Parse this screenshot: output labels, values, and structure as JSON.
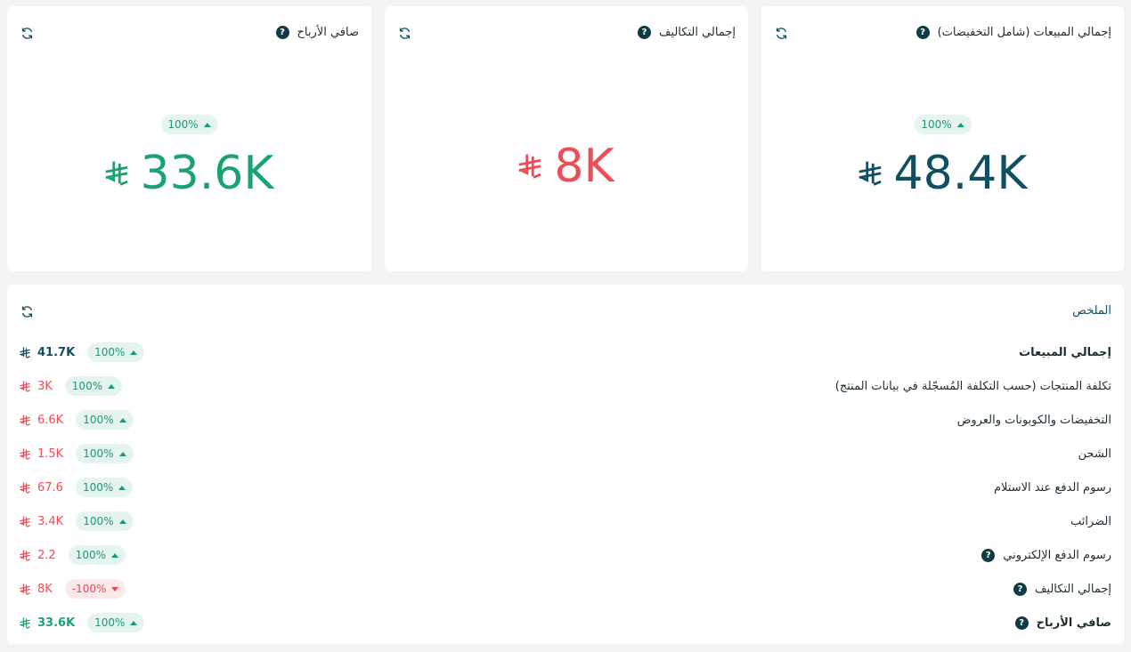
{
  "colors": {
    "primary": "#0f4f5f",
    "positive": "#1aa36f",
    "negative": "#ec4d57",
    "badge_up_bg": "#e4f5ee",
    "badge_down_bg": "#fde9ea"
  },
  "kpis": {
    "sales": {
      "title": "إجمالي المبيعات (شامل التخفيضات)",
      "help": "?",
      "change": "100%",
      "value": "48.4K",
      "currency_icon": "riyal-icon"
    },
    "costs": {
      "title": "إجمالي التكاليف",
      "help": "?",
      "value": "8K",
      "currency_icon": "riyal-icon"
    },
    "profit": {
      "title": "صافي الأرباح",
      "help": "?",
      "change": "100%",
      "value": "33.6K",
      "currency_icon": "riyal-icon"
    }
  },
  "summary": {
    "title": "الملخص",
    "rows": [
      {
        "label": "إجمالي المبيعات",
        "bold": true,
        "help": false,
        "change": "100%",
        "direction": "up",
        "value": "41.7K",
        "tone": "primary"
      },
      {
        "label": "تكلفة المنتجات (حسب التكلفة المُسجّلة في بيانات المنتج)",
        "bold": false,
        "help": false,
        "change": "100%",
        "direction": "up",
        "value": "3K",
        "tone": "negative"
      },
      {
        "label": "التخفيضات والكوبونات والعروض",
        "bold": false,
        "help": false,
        "change": "100%",
        "direction": "up",
        "value": "6.6K",
        "tone": "negative"
      },
      {
        "label": "الشحن",
        "bold": false,
        "help": false,
        "change": "100%",
        "direction": "up",
        "value": "1.5K",
        "tone": "negative"
      },
      {
        "label": "رسوم الدفع عند الاستلام",
        "bold": false,
        "help": false,
        "change": "100%",
        "direction": "up",
        "value": "67.6",
        "tone": "negative"
      },
      {
        "label": "الضرائب",
        "bold": false,
        "help": false,
        "change": "100%",
        "direction": "up",
        "value": "3.4K",
        "tone": "negative"
      },
      {
        "label": "رسوم الدفع الإلكتروني",
        "bold": false,
        "help": true,
        "change": "100%",
        "direction": "up",
        "value": "2.2",
        "tone": "negative"
      },
      {
        "label": "إجمالي التكاليف",
        "bold": false,
        "help": true,
        "change": "-100%",
        "direction": "down",
        "value": "8K",
        "tone": "negative"
      },
      {
        "label": "صافي الأرباح",
        "bold": true,
        "help": true,
        "change": "100%",
        "direction": "up",
        "value": "33.6K",
        "tone": "positive"
      }
    ]
  }
}
